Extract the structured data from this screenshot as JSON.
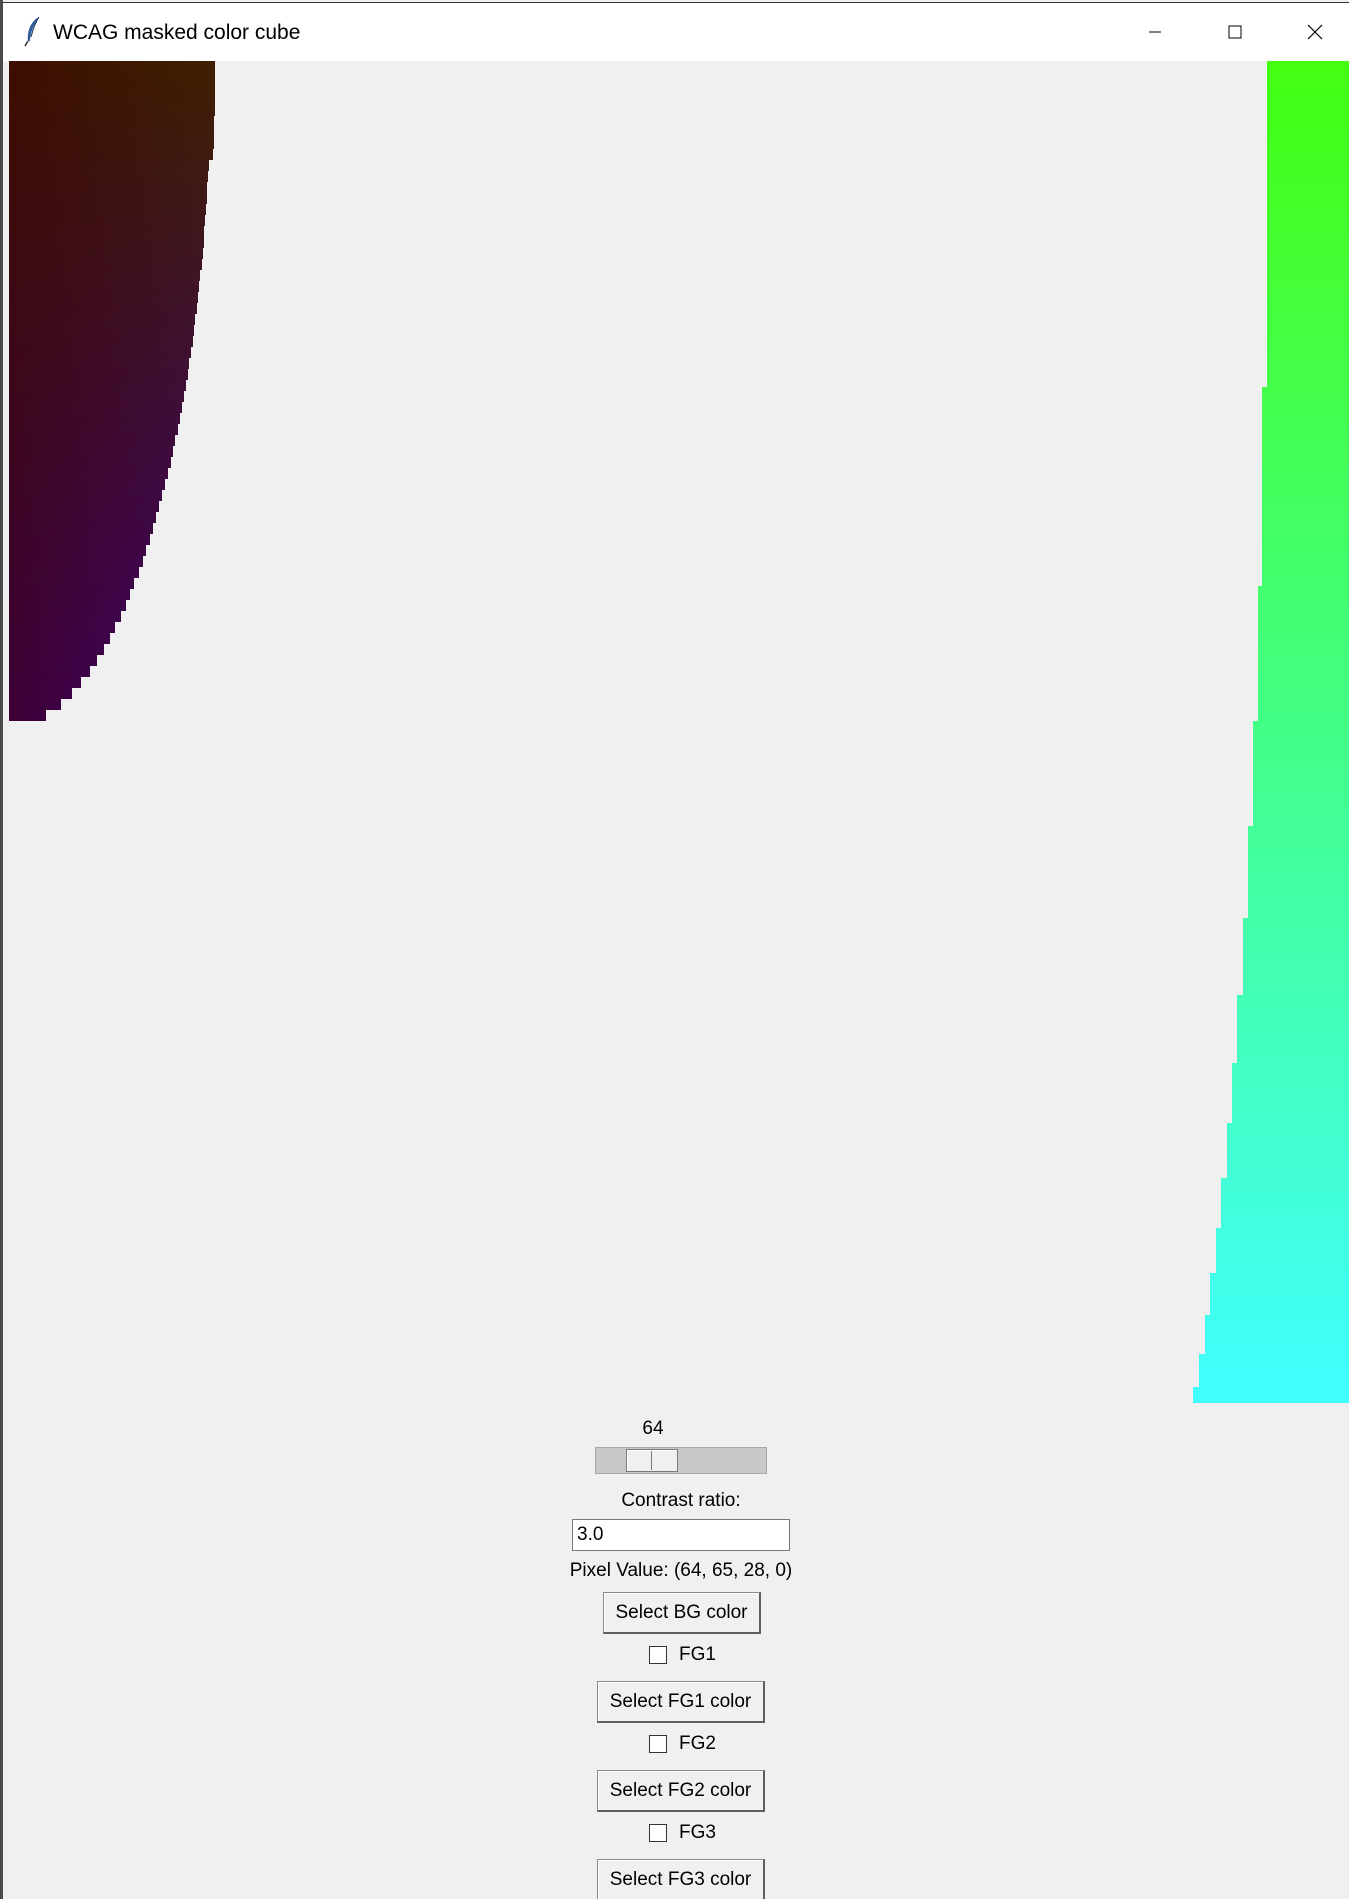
{
  "window": {
    "title": "WCAG masked color cube",
    "icon": "feather-icon",
    "controls": {
      "minimize": "minimize-icon",
      "maximize": "maximize-icon",
      "close": "close-icon"
    }
  },
  "canvas": {
    "left_region_colors": {
      "top": "#3f1f00",
      "top_left": "#3a0000",
      "bottom": "#3f0075"
    },
    "right_region_colors": {
      "top": "#44ff11",
      "bottom": "#41ffff"
    }
  },
  "controls": {
    "scale": {
      "value": "64",
      "level": 64
    },
    "contrast_label": "Contrast ratio:",
    "contrast_value": "3.0",
    "pixel_value": "Pixel Value: (64, 65, 28, 0)",
    "select_bg_label": "Select BG color",
    "fg1": {
      "checkbox_label": "FG1",
      "checked": false,
      "button_label": "Select FG1 color"
    },
    "fg2": {
      "checkbox_label": "FG2",
      "checked": false,
      "button_label": "Select FG2 color"
    },
    "fg3": {
      "checkbox_label": "FG3",
      "checked": false,
      "button_label": "Select FG3 color"
    }
  }
}
